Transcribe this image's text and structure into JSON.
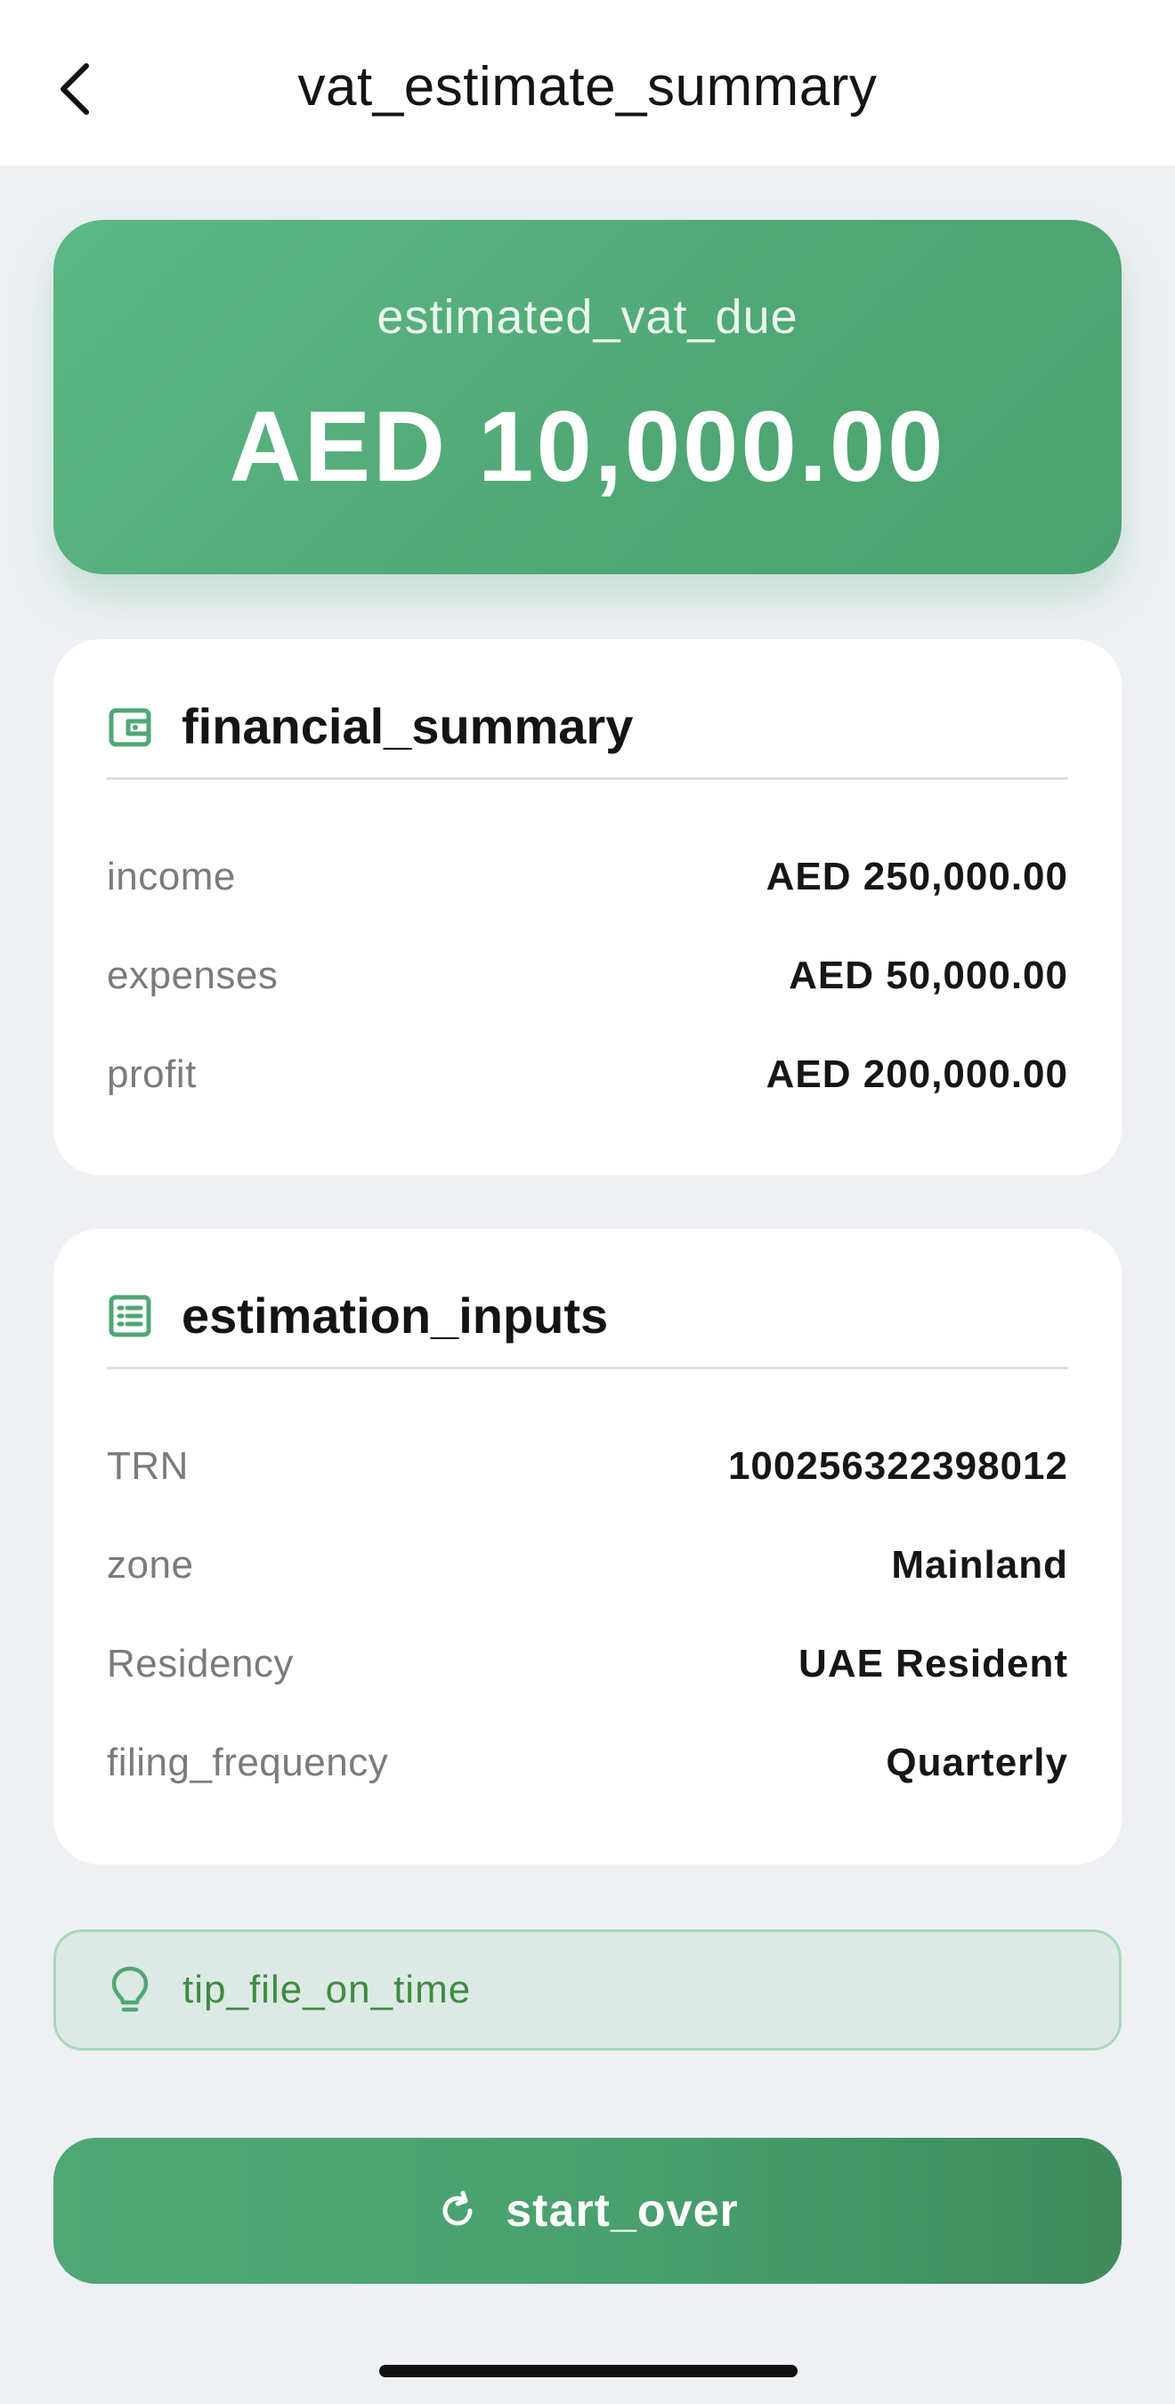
{
  "header": {
    "title": "vat_estimate_summary",
    "back_icon": "chevron-left-icon"
  },
  "hero": {
    "label": "estimated_vat_due",
    "amount": "AED 10,000.00"
  },
  "financial_summary": {
    "title": "financial_summary",
    "icon": "wallet-icon",
    "rows": [
      {
        "label": "income",
        "value": "AED 250,000.00"
      },
      {
        "label": "expenses",
        "value": "AED 50,000.00"
      },
      {
        "label": "profit",
        "value": "AED 200,000.00"
      }
    ]
  },
  "estimation_inputs": {
    "title": "estimation_inputs",
    "icon": "list-icon",
    "rows": [
      {
        "label": "TRN",
        "value": "100256322398012"
      },
      {
        "label": "zone",
        "value": "Mainland"
      },
      {
        "label": "Residency",
        "value": "UAE Resident"
      },
      {
        "label": "filing_frequency",
        "value": "Quarterly"
      }
    ]
  },
  "tip": {
    "icon": "lightbulb-icon",
    "text": "tip_file_on_time"
  },
  "actions": {
    "start_over_label": "start_over",
    "start_over_icon": "refresh-icon"
  },
  "colors": {
    "primary_green": "#4fa774",
    "tip_background": "#dce9e4",
    "tip_text": "#3f8b43",
    "page_background": "#eef0f4"
  }
}
